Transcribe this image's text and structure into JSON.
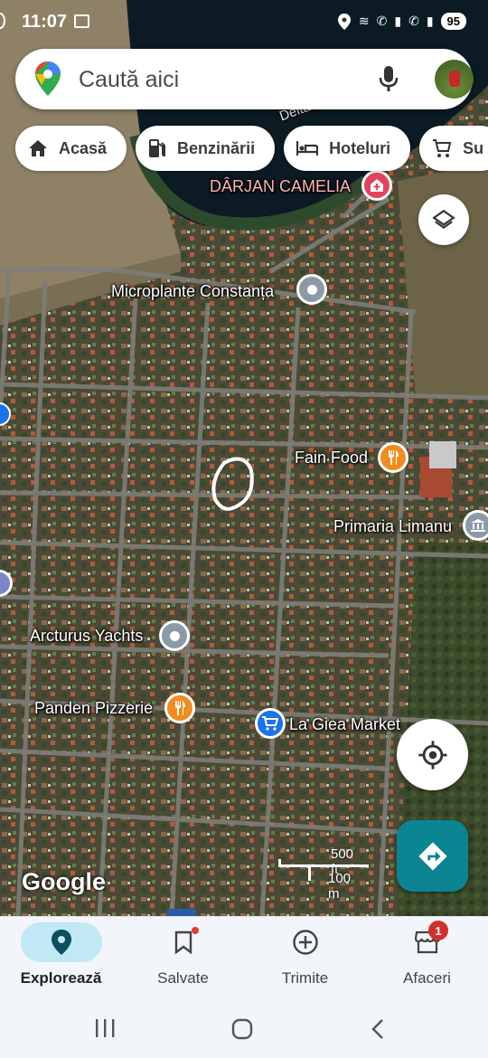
{
  "status_bar": {
    "time": "11:07",
    "battery": "95"
  },
  "search": {
    "placeholder": "Caută aici"
  },
  "chips": [
    {
      "label": "Acasă",
      "icon": "home-icon"
    },
    {
      "label": "Benzinării",
      "icon": "gas-station-icon"
    },
    {
      "label": "Hoteluri",
      "icon": "hotel-icon"
    },
    {
      "label": "Su",
      "icon": "cart-icon"
    }
  ],
  "map": {
    "water_label": "Delta Lim",
    "places": [
      {
        "name": "DÂRJAN CAMELIA",
        "kind": "hospital",
        "color": "#e2445f"
      },
      {
        "name": "Microplante Constanța",
        "kind": "generic",
        "color": "#8c9aa6"
      },
      {
        "name": "Fain Food",
        "kind": "restaurant",
        "color": "#f08c1e"
      },
      {
        "name": "Primaria Limanu",
        "kind": "government",
        "color": "#8c9aa6"
      },
      {
        "name": "Arcturus Yachts",
        "kind": "generic",
        "color": "#8c9aa6"
      },
      {
        "name": "Panden Pizzerie",
        "kind": "restaurant",
        "color": "#f08c1e"
      },
      {
        "name": "La Giea Market",
        "kind": "shopping",
        "color": "#1a73e8"
      }
    ],
    "scale": {
      "imperial": "500 ft",
      "metric": "100 m"
    },
    "attribution": "Google"
  },
  "bottom_nav": {
    "items": [
      {
        "label": "Explorează",
        "icon": "explore-pin-icon",
        "active": true
      },
      {
        "label": "Salvate",
        "icon": "bookmark-icon",
        "active": false
      },
      {
        "label": "Trimite",
        "icon": "add-circle-icon",
        "active": false
      },
      {
        "label": "Afaceri",
        "icon": "business-icon",
        "active": false,
        "badge": "1"
      }
    ]
  },
  "colors": {
    "accent": "#0b8591",
    "active_nav": "#c2e7f5"
  }
}
